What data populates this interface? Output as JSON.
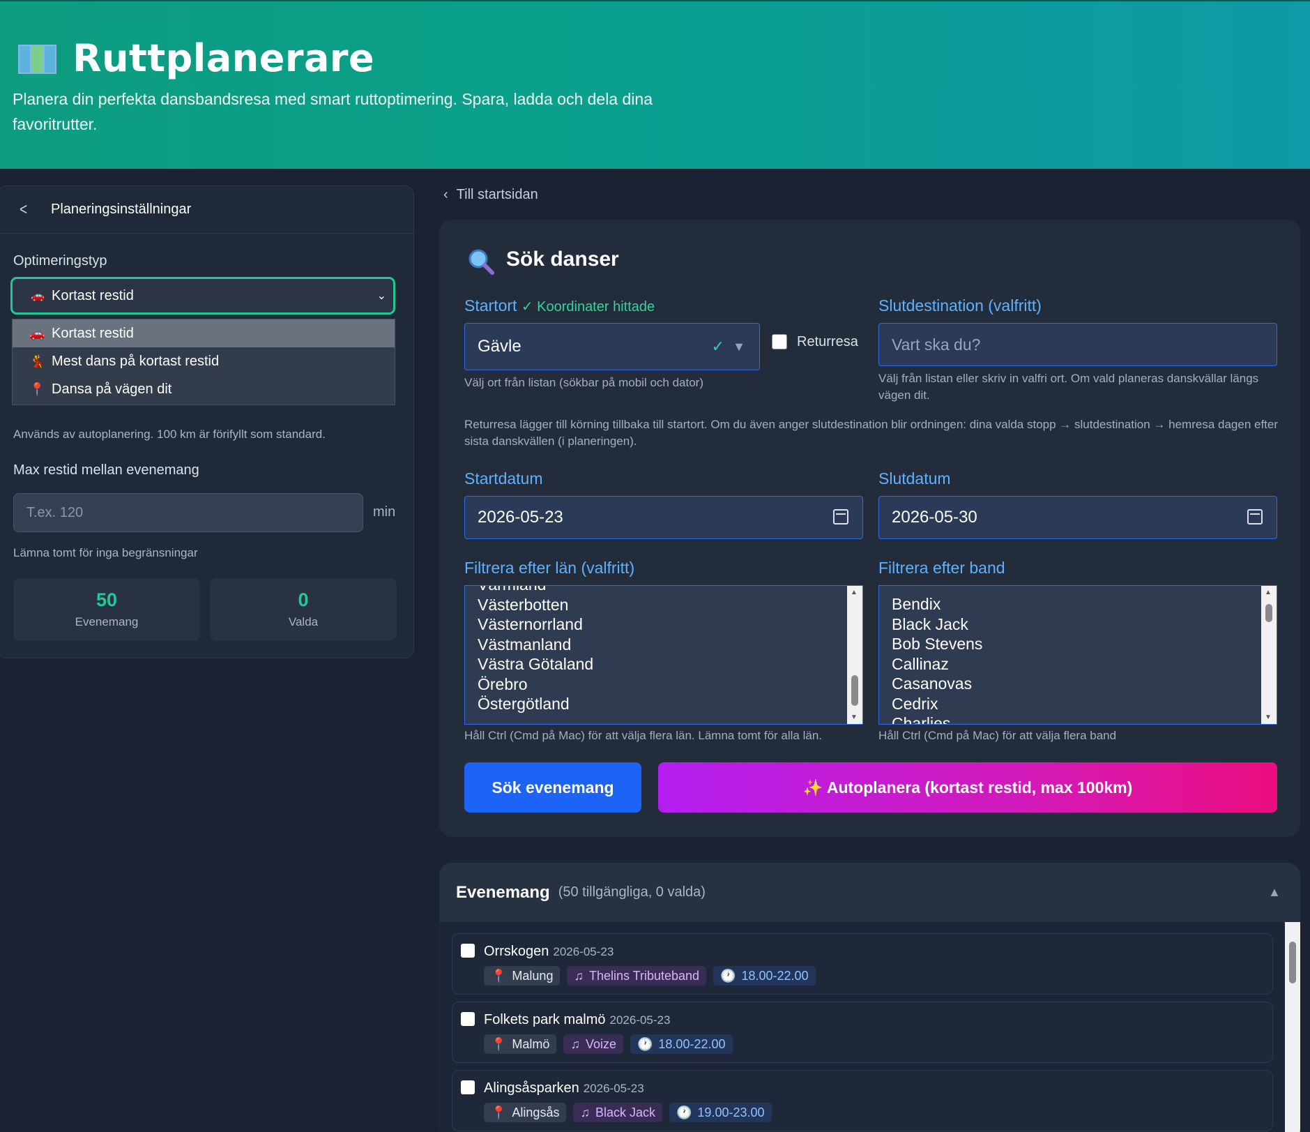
{
  "header": {
    "title": "Ruttplanerare",
    "subtitle": "Planera din perfekta dansbandsresa med smart ruttoptimering. Spara, ladda och dela dina favoritrutter."
  },
  "sidebar": {
    "title": "Planeringsinställningar",
    "optimization_label": "Optimeringstyp",
    "optimization_selected": "Kortast restid",
    "optimization_options": [
      "Kortast restid",
      "Mest dans på kortast restid",
      "Dansa på vägen dit"
    ],
    "distance_hint": "Används av autoplanering. 100 km är förifyllt som standard.",
    "max_travel_label": "Max restid mellan evenemang",
    "max_travel_placeholder": "T.ex. 120",
    "max_travel_unit": "min",
    "max_travel_hint": "Lämna tomt för inga begränsningar",
    "stats": [
      {
        "value": "50",
        "label": "Evenemang"
      },
      {
        "value": "0",
        "label": "Valda"
      }
    ]
  },
  "back_link": "Till startsidan",
  "search": {
    "title": "Sök danser",
    "start_label": "Startort",
    "start_status": "✓ Koordinater hittade",
    "start_value": "Gävle",
    "start_hint": "Välj ort från listan (sökbar på mobil och dator)",
    "return_label": "Returresa",
    "dest_label": "Slutdestination (valfritt)",
    "dest_placeholder": "Vart ska du?",
    "dest_hint": "Välj från listan eller skriv in valfri ort. Om vald planeras danskvällar längs vägen dit.",
    "return_note": "Returresa lägger till körning tillbaka till startort. Om du även anger slutdestination blir ordningen: dina valda stopp → slutdestination → hemresa dagen efter sista danskvällen (i planeringen).",
    "start_date_label": "Startdatum",
    "start_date": "2026-05-23",
    "end_date_label": "Slutdatum",
    "end_date": "2026-05-30",
    "county_label": "Filtrera efter län (valfritt)",
    "counties": [
      "Värmland",
      "Västerbotten",
      "Västernorrland",
      "Västmanland",
      "Västra Götaland",
      "Örebro",
      "Östergötland"
    ],
    "county_hint": "Håll Ctrl (Cmd på Mac) för att välja flera län. Lämna tomt för alla län.",
    "band_label": "Filtrera efter band",
    "bands": [
      "Bendix",
      "Black Jack",
      "Bob Stevens",
      "Callinaz",
      "Casanovas",
      "Cedrix",
      "Charlies"
    ],
    "band_hint": "Håll Ctrl (Cmd på Mac) för att välja flera band",
    "search_button": "Sök evenemang",
    "autoplan_button": "✨ Autoplanera (kortast restid, max 100km)"
  },
  "events": {
    "title": "Evenemang",
    "count": "(50 tillgängliga, 0 valda)",
    "items": [
      {
        "name": "Orrskogen",
        "date": "2026-05-23",
        "location": "Malung",
        "band": "Thelins Tributeband",
        "time": "18.00-22.00"
      },
      {
        "name": "Folkets park malmö",
        "date": "2026-05-23",
        "location": "Malmö",
        "band": "Voize",
        "time": "18.00-22.00"
      },
      {
        "name": "Alingsåsparken",
        "date": "2026-05-23",
        "location": "Alingsås",
        "band": "Black Jack",
        "time": "19.00-23.00"
      }
    ]
  }
}
